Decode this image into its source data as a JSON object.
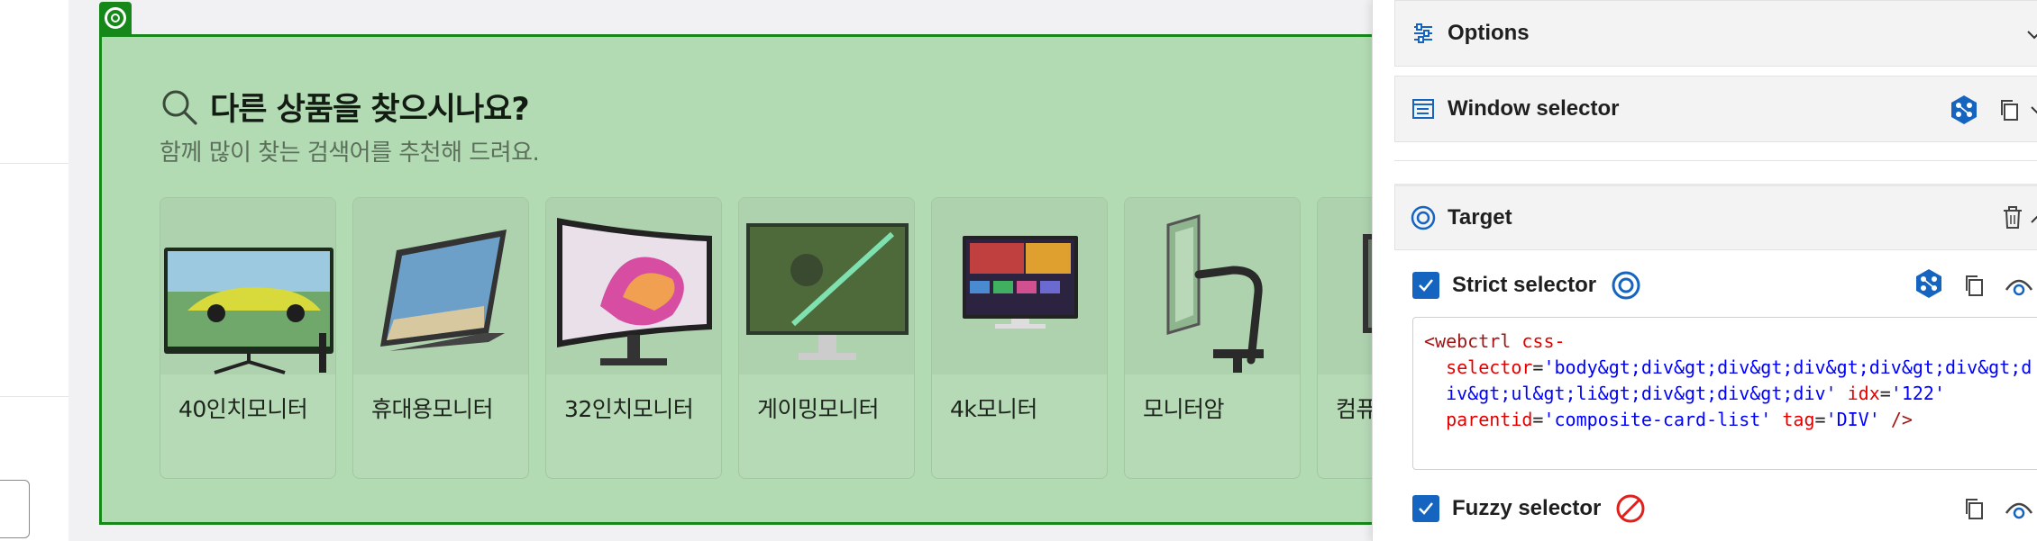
{
  "page": {
    "section_title": "다른 상품을 찾으시나요?",
    "section_subtitle": "함께 많이 찾는 검색어를 추천해 드려요.",
    "cards": [
      {
        "label": "40인치모니터",
        "image": "monitor-sports-car"
      },
      {
        "label": "휴대용모니터",
        "image": "portable-monitor-beach"
      },
      {
        "label": "32인치모니터",
        "image": "curved-monitor-swirl"
      },
      {
        "label": "게이밍모니터",
        "image": "gaming-monitor-warrior"
      },
      {
        "label": "4k모니터",
        "image": "smart-monitor-apps"
      },
      {
        "label": "모니터암",
        "image": "monitor-arm"
      },
      {
        "label": "컴퓨터모니터",
        "image": "monitor-partial"
      }
    ]
  },
  "panel": {
    "options_title": "Options",
    "window_selector_title": "Window selector",
    "target_title": "Target",
    "strict_selector_label": "Strict selector",
    "fuzzy_selector_label": "Fuzzy selector",
    "code_lines": [
      "<webctrl css-",
      "  selector='body&gt;div&gt;div&gt;div&gt;div&gt;div&gt;d",
      "  iv&gt;ul&gt;li&gt;div&gt;div&gt;div' idx='122'",
      "  parentid='composite-card-list' tag='DIV' />"
    ],
    "code_segments": {
      "l1_tag": "<webctrl",
      "l1_attr": "css-",
      "l2_attr": "selector",
      "l2_val": "'body&gt;div&gt;div&gt;div&gt;div&gt;div&gt;d",
      "l3_val": "iv&gt;ul&gt;li&gt;div&gt;div&gt;div'",
      "l3_attr": "idx",
      "l3_val2": "'122'",
      "l4_attr": "parentid",
      "l4_val": "'composite-card-list'",
      "l4_attr2": "tag",
      "l4_val2": "'DIV'",
      "l4_end": " />"
    }
  },
  "colors": {
    "highlight_border": "#16881a",
    "highlight_fill": "#b3dbb3",
    "accent_blue": "#1565c0",
    "danger_red": "#e0201c"
  }
}
